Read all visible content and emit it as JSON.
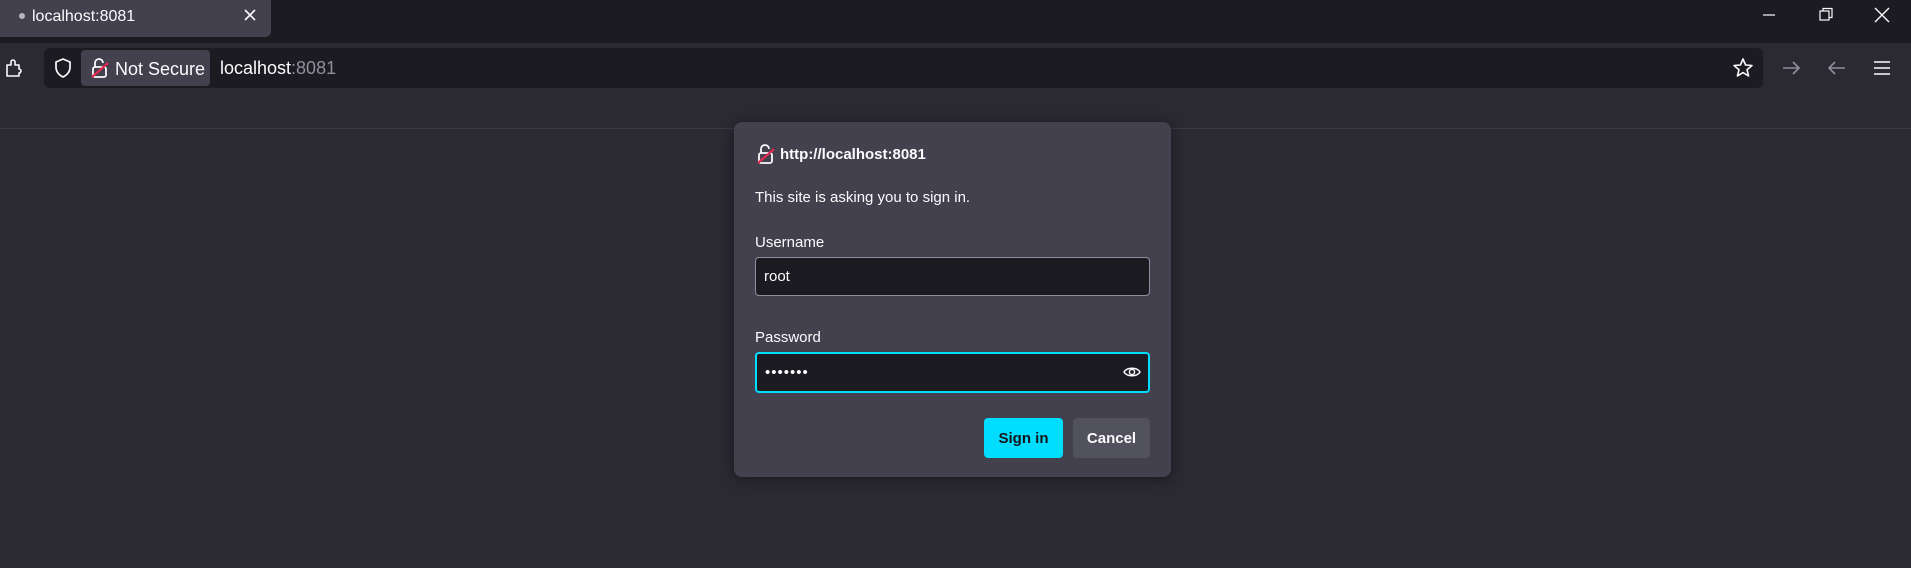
{
  "tab": {
    "title": "localhost:8081"
  },
  "toolbar": {
    "identity_label": "Not Secure",
    "url_host": "localhost",
    "url_port": ":8081"
  },
  "dialog": {
    "origin": "http://localhost:8081",
    "message": "This site is asking you to sign in.",
    "username_label": "Username",
    "username_value": "root",
    "password_label": "Password",
    "password_masked": "•••••••",
    "sign_in_label": "Sign in",
    "cancel_label": "Cancel"
  },
  "colors": {
    "accent": "#00ddff",
    "insecure_lock": "#e22850",
    "dialog_bg": "#42414d",
    "page_bg": "#2b2a33"
  }
}
